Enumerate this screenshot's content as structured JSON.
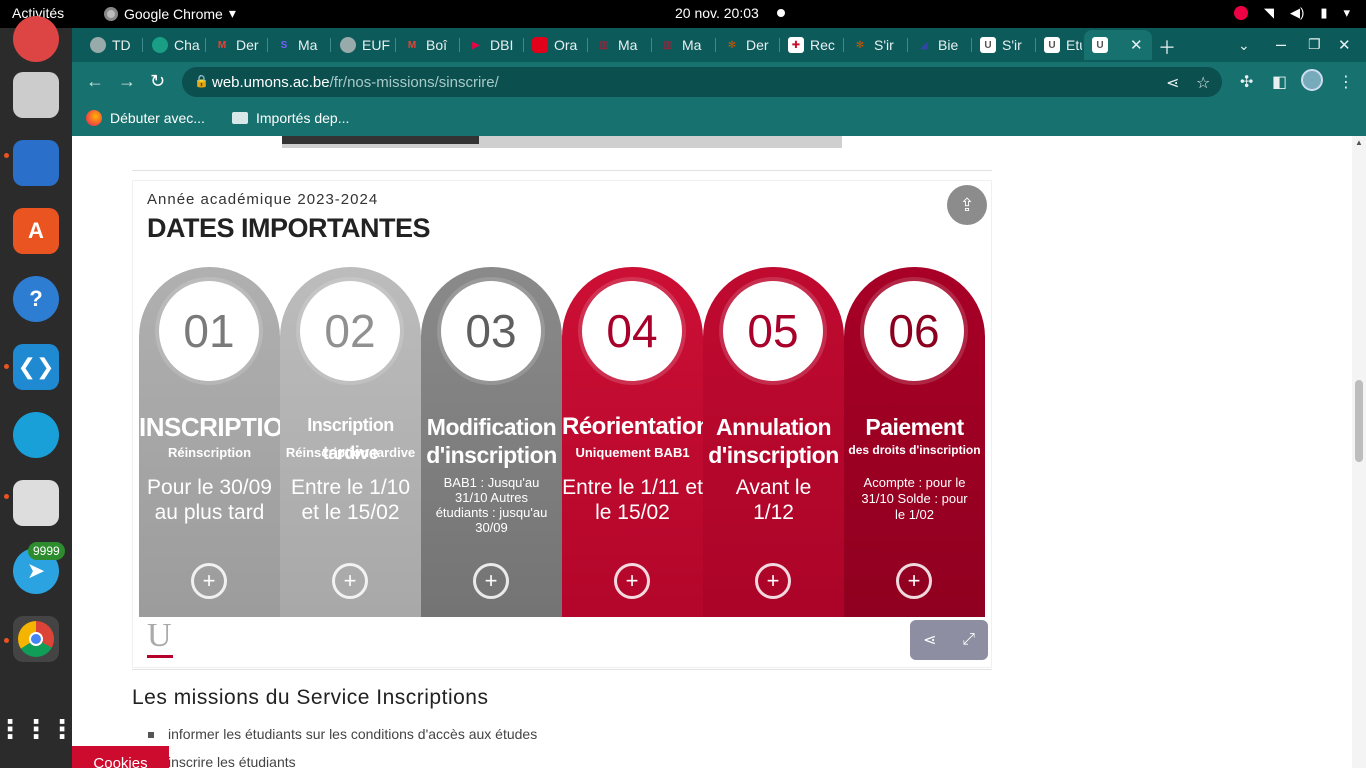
{
  "topbar": {
    "activities": "Activités",
    "app_name": "Google Chrome",
    "clock": "20 nov.  20:03"
  },
  "dock": {
    "badge": "9999"
  },
  "tabs": [
    {
      "label": "TD",
      "color": "#9aa"
    },
    {
      "label": "Cha",
      "color": "#1a9f86"
    },
    {
      "label": "Der",
      "color": "#ea4335"
    },
    {
      "label": "Ma",
      "color": "#3b2d7a"
    },
    {
      "label": "EUF",
      "color": "#9aa"
    },
    {
      "label": "Boî",
      "color": "#ea4335"
    },
    {
      "label": "DBI",
      "color": "#b51f6e"
    },
    {
      "label": "Ora",
      "color": "#e2001a"
    },
    {
      "label": "Ma",
      "color": "#c8102e"
    },
    {
      "label": "Ma",
      "color": "#c8102e"
    },
    {
      "label": "Der",
      "color": "#cc5500"
    },
    {
      "label": "Rec",
      "color": "#c8102e"
    },
    {
      "label": "S'ir",
      "color": "#cc5500"
    },
    {
      "label": "Bie",
      "color": "#3344aa"
    },
    {
      "label": "S'ir",
      "color": "#ffffff"
    },
    {
      "label": "Etu",
      "color": "#ffffff"
    },
    {
      "label": "",
      "color": "#ffffff"
    }
  ],
  "address": {
    "host": "web.umons.ac.be",
    "path": "/fr/nos-missions/sinscrire/"
  },
  "bookmarks": {
    "item1": "Débuter avec...",
    "item2": "Importés dep..."
  },
  "infographic": {
    "year": "Année académique 2023-2024",
    "title": "DATES IMPORTANTES",
    "columns": [
      {
        "num": "01",
        "label": "INSCRIPTION",
        "sub": "Réinscription",
        "desc": "Pour le 30/09 au plus tard",
        "bg": "#a3a3a3",
        "numcolor": "#7a7a7a"
      },
      {
        "num": "02",
        "label": "Inscription tardive",
        "sub": "Réinscription tardive",
        "desc": "Entre le 1/10 et le 15/02",
        "bg": "#b0b0b0",
        "numcolor": "#909090"
      },
      {
        "num": "03",
        "label": "Modification d'inscription",
        "sub": "",
        "desc": "BAB1 : Jusqu'au 31/10 Autres étudiants : jusqu'au 30/09",
        "bg": "#7d7d7d",
        "numcolor": "#5f5f5f"
      },
      {
        "num": "04",
        "label": "Réorientation",
        "sub": "Uniquement BAB1",
        "desc": "Entre le 1/11 et le 15/02",
        "bg": "#c0092e",
        "numcolor": "#a8002a"
      },
      {
        "num": "05",
        "label": "Annulation d'inscription",
        "sub": "",
        "desc": "Avant le 1/12",
        "bg": "#b5052a",
        "numcolor": "#a8002a"
      },
      {
        "num": "06",
        "label": "Paiement",
        "sub": "des droits d'inscription",
        "desc": "Acompte : pour le 31/10 Solde : pour le 1/02",
        "bg": "#9e0022",
        "numcolor": "#8a001e"
      }
    ],
    "logo_letter": "U"
  },
  "missions": {
    "title": "Les missions du Service Inscriptions",
    "items": [
      "informer les étudiants sur les conditions d'accès aux études",
      "inscrire les étudiants"
    ]
  },
  "cookies": "Cookies"
}
